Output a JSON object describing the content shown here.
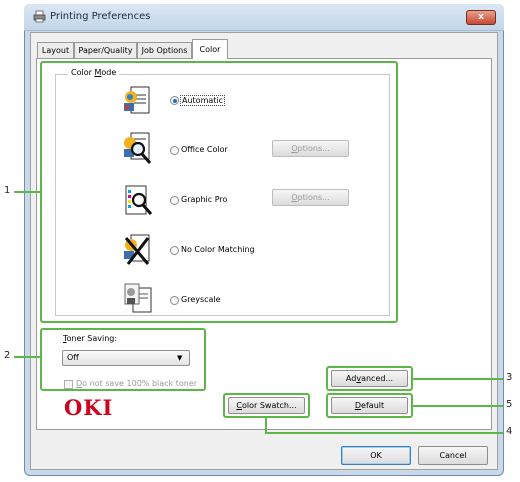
{
  "window": {
    "title": "Printing Preferences",
    "close_glyph": "x"
  },
  "tabs": [
    {
      "label": "Layout"
    },
    {
      "label": "Paper/Quality"
    },
    {
      "label": "Job Options"
    },
    {
      "label": "Color",
      "active": true
    }
  ],
  "color_mode": {
    "label_prefix": "Color ",
    "label_mnemonic": "M",
    "label_suffix": "ode",
    "options": [
      {
        "label": "Automatic",
        "selected": true,
        "icon": "printer-color-doc-icon"
      },
      {
        "label": "Office Color",
        "selected": false,
        "icon": "magnifier-color-doc-icon",
        "button": {
          "mnemonic": "O",
          "rest": "ptions..."
        }
      },
      {
        "label": "Graphic Pro",
        "selected": false,
        "icon": "magnifier-cmy-doc-icon",
        "button": {
          "mnemonic": "O",
          "rest": "ptions..."
        }
      },
      {
        "label": "No Color Matching",
        "selected": false,
        "icon": "crossed-color-doc-icon"
      },
      {
        "label": "Greyscale",
        "selected": false,
        "icon": "greyscale-doc-icon"
      }
    ]
  },
  "toner": {
    "label_mnemonic": "T",
    "label_rest": "oner Saving:",
    "value": "Off",
    "checkbox_mnemonic": "D",
    "checkbox_rest": "o not save 100% black toner",
    "checkbox_checked": false
  },
  "buttons": {
    "advanced_pre": "Ad",
    "advanced_mnemonic": "v",
    "advanced_post": "anced...",
    "default_mnemonic": "D",
    "default_rest": "efault",
    "swatch_mnemonic": "C",
    "swatch_rest": "olor Swatch...",
    "ok": "OK",
    "cancel": "Cancel"
  },
  "brand": {
    "logo": "OKI",
    "color": "#d0021b"
  },
  "annotations": {
    "c1": "1",
    "c2": "2",
    "c3": "3",
    "c4": "4",
    "c5": "5"
  },
  "colors": {
    "highlight": "#5db748",
    "accent": "#1b6ec2"
  }
}
